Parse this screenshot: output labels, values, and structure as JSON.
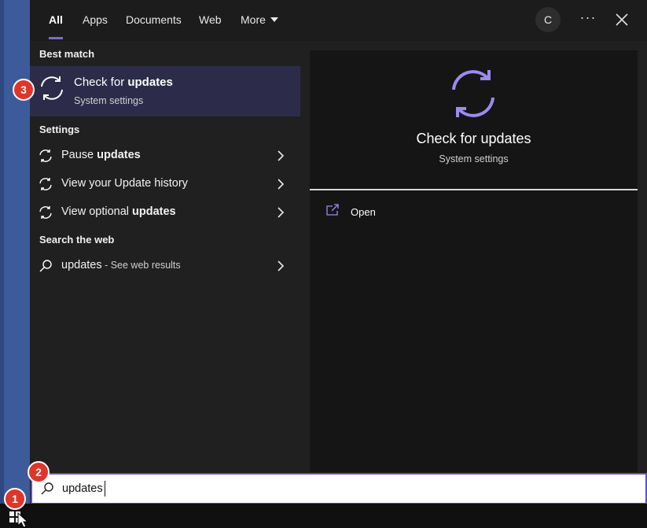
{
  "tabs": [
    {
      "label": "All",
      "active": true
    },
    {
      "label": "Apps"
    },
    {
      "label": "Documents"
    },
    {
      "label": "Web"
    },
    {
      "label": "More"
    }
  ],
  "header": {
    "avatar_initial": "C",
    "more_icon": "ellipsis-icon",
    "close_icon": "close-icon"
  },
  "results": {
    "best_match_heading": "Best match",
    "best_match": {
      "title_plain": "Check for ",
      "title_bold": "updates",
      "subtitle": "System settings",
      "icon": "refresh-sync-icon"
    },
    "settings_heading": "Settings",
    "settings_items": [
      {
        "plain": "Pause ",
        "bold": "updates",
        "plain_after": ""
      },
      {
        "plain": "View your Update history",
        "bold": "",
        "plain_after": ""
      },
      {
        "plain": "View optional ",
        "bold": "updates",
        "plain_after": ""
      }
    ],
    "web_heading": "Search the web",
    "web_item": {
      "query": "updates",
      "suffix": " - See web results"
    }
  },
  "preview": {
    "title": "Check for updates",
    "subtitle": "System settings",
    "actions": [
      {
        "label": "Open",
        "icon": "open-external-icon"
      }
    ]
  },
  "search": {
    "value": "updates"
  },
  "annotations": [
    "1",
    "2",
    "3"
  ],
  "colors": {
    "accent": "#7b6bd6",
    "selected_row": "#2c2c4a",
    "desktop_blue": "#3d5b9a",
    "badge_red": "#e0352b",
    "search_border": "#5b4fd0"
  }
}
